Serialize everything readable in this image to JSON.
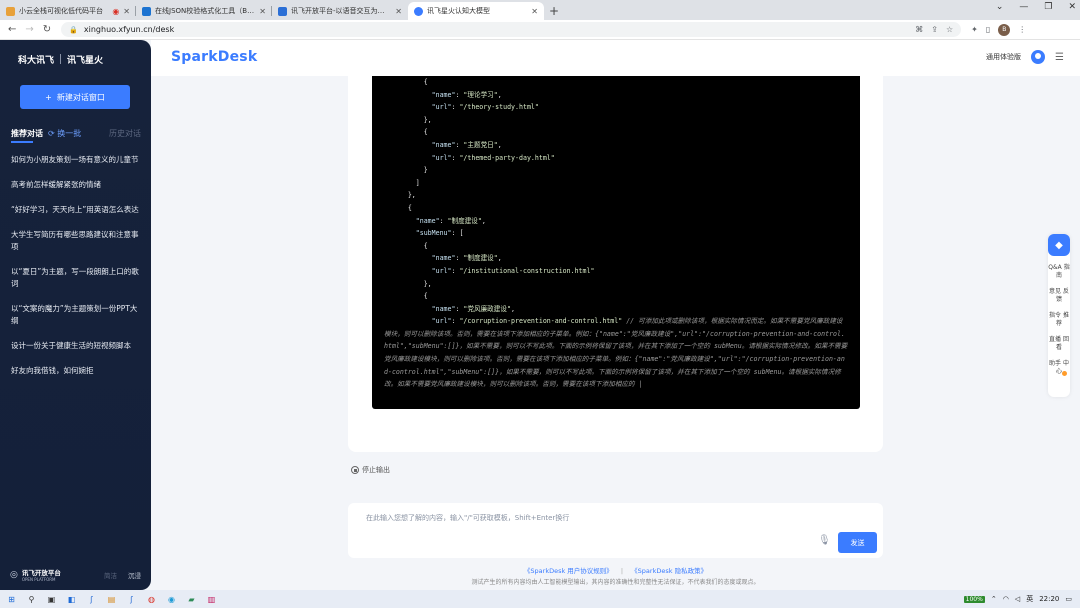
{
  "browser": {
    "tabs": [
      {
        "title": "小云全栈可视化低代码平台",
        "color": "#e8a13a",
        "active": false,
        "rec": true
      },
      {
        "title": "在线JSON校验格式化工具（Be JSON）",
        "color": "#1c73d1",
        "active": false,
        "rec": false
      },
      {
        "title": "讯飞开放平台-以语音交互为核心的...",
        "color": "#2b6fd6",
        "active": false,
        "rec": false
      },
      {
        "title": "讯飞星火认知大模型",
        "color": "#3b7cff",
        "active": true,
        "rec": false
      }
    ],
    "url": "xinghuo.xfyun.cn/desk",
    "profile_initial": "B"
  },
  "sidebar": {
    "logo_left": "科大讯飞",
    "logo_right": "讯飞星火",
    "new_chat": "新建对话窗口",
    "tab_recommend": "推荐对话",
    "tab_refresh": "换一批",
    "tab_history": "历史对话",
    "items": [
      "如何为小朋友策划一场有意义的儿童节",
      "高考前怎样缓解紧张的情绪",
      "“好好学习，天天向上”用英语怎么表达",
      "大学生写简历有哪些思路建议和注意事项",
      "以“夏日”为主题，写一段朗朗上口的歌词",
      "以“文案的魔力”为主题策划一份PPT大纲",
      "设计一份关于健康生活的短视频脚本",
      "好友向我借钱，如何婉拒"
    ],
    "platform_name": "讯飞开放平台",
    "platform_sub": "OPEN PLATFORM",
    "mode_light": "简洁",
    "mode_dark": "沉浸"
  },
  "header": {
    "brand": "SparkDesk",
    "version": "通用体验版"
  },
  "code_lines": [
    {
      "t": "          {"
    },
    {
      "t": "            \"name\": \"理论学习\","
    },
    {
      "t": "            \"url\": \"/theory-study.html\""
    },
    {
      "t": "          },"
    },
    {
      "t": "          {"
    },
    {
      "t": "            \"name\": \"主题党日\","
    },
    {
      "t": "            \"url\": \"/themed-party-day.html\""
    },
    {
      "t": "          }"
    },
    {
      "t": "        ]"
    },
    {
      "t": "      },"
    },
    {
      "t": "      {"
    },
    {
      "t": "        \"name\": \"制度建设\","
    },
    {
      "t": "        \"subMenu\": ["
    },
    {
      "t": "          {"
    },
    {
      "t": "            \"name\": \"制度建设\","
    },
    {
      "t": "            \"url\": \"/institutional-construction.html\""
    },
    {
      "t": "          },"
    },
    {
      "t": "          {"
    },
    {
      "t": "            \"name\": \"党风廉政建设\","
    }
  ],
  "code_last_line": "            \"url\": \"/corruption-prevention-and-control.html\"",
  "code_comment": " // 可添加此项或删除该项，根据实际情况而定。如果不需要党风廉政建设模块，则可以删除该项。否则，需要在该项下添加相应的子菜单。例如：{\"name\":\"党风廉政建设\",\"url\":\"/corruption-prevention-and-control.html\",\"subMenu\":[]}，如果不需要，则可以不写此项。下面的示例将保留了该项，并在其下添加了一个空的 subMenu。请根据实际情况修改。如果不需要党风廉政建设模块，则可以删除该项。否则，需要在该项下添加相应的子菜单。例如：{\"name\":\"党风廉政建设\",\"url\":\"/corruption-prevention-and-control.html\",\"subMenu\":[]}，如果不需要，则可以不写此项。下面的示例将保留了该项，并在其下添加了一个空的 subMenu。请根据实际情况修改。如果不需要党风廉政建设模块，则可以删除该项。否则，需要在该项下添加相应的 |",
  "stop_output": "停止输出",
  "input": {
    "placeholder": "在此输入您想了解的内容，输入\"/\"可获取模板，Shift+Enter换行",
    "send": "发送"
  },
  "footer": {
    "link1": "《SparkDesk 用户协议规则》",
    "link2": "《SparkDesk 隐私政策》",
    "disclaimer": "测试产生的所有内容均由人工智能模型输出，其内容的准确性和完整性无法保证，不代表我们的态度或观点。"
  },
  "right_tools": [
    "Q&A 指南",
    "意见 反馈",
    "指令 推荐",
    "直播 回看",
    "助手 中心"
  ],
  "taskbar": {
    "battery": "100%",
    "time": "22:20"
  }
}
